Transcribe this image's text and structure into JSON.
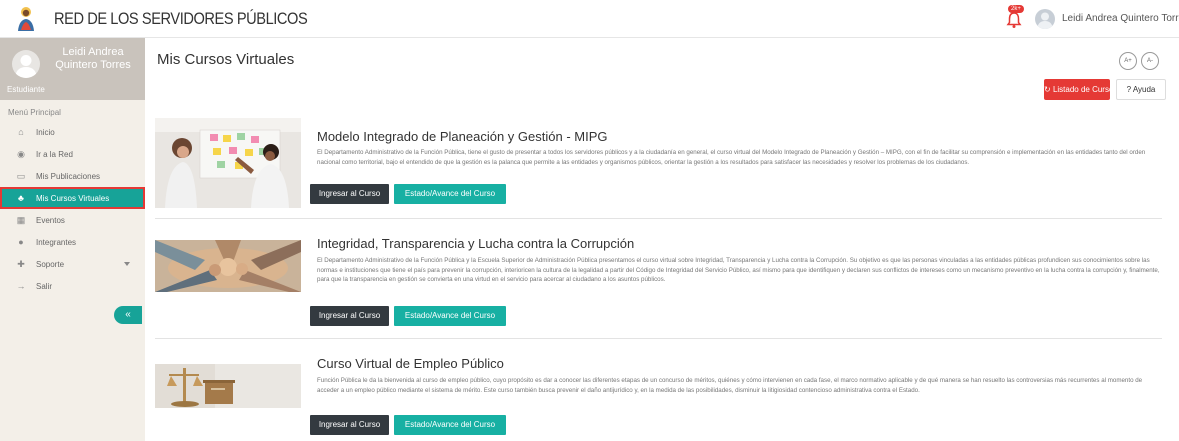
{
  "app": {
    "brand": "RED DE LOS SERVIDORES PÚBLICOS",
    "notification_badge": "2k+",
    "user_name": "Leidi Andrea Quintero Torres"
  },
  "sidebar": {
    "profile_name": "Leidi Andrea Quintero Torres",
    "profile_role": "Estudiante",
    "menu_title": "Menú Principal",
    "items": [
      {
        "label": "Inicio",
        "icon": "home-icon",
        "glyph": "⌂"
      },
      {
        "label": "Ir a la Red",
        "icon": "eye-icon",
        "glyph": "◉"
      },
      {
        "label": "Mis Publicaciones",
        "icon": "document-icon",
        "glyph": "▭"
      },
      {
        "label": "Mis Cursos Virtuales",
        "icon": "courses-icon",
        "glyph": "♣"
      },
      {
        "label": "Eventos",
        "icon": "calendar-icon",
        "glyph": "▦"
      },
      {
        "label": "Integrantes",
        "icon": "user-icon",
        "glyph": "●"
      },
      {
        "label": "Soporte",
        "icon": "support-icon",
        "glyph": "✚"
      },
      {
        "label": "Salir",
        "icon": "logout-icon",
        "glyph": "→"
      }
    ],
    "collapse_glyph": "«"
  },
  "main": {
    "title": "Mis Cursos Virtuales",
    "font_increase": "A+",
    "font_decrease": "A-",
    "listado_label": "Listado de Cursos",
    "ayuda_label": "? Ayuda"
  },
  "courses": [
    {
      "title": "Modelo Integrado de Planeación y Gestión - MIPG",
      "description": "El Departamento Administrativo de la Función Pública, tiene el gusto de presentar a todos los servidores públicos y a la ciudadanía en general, el curso virtual del Modelo Integrado de Planeación y Gestión – MIPG, con el fin de facilitar su comprensión e implementación en las entidades tanto del orden nacional como territorial, bajo el entendido de que la gestión es la palanca que permite a las entidades y organismos públicos, orientar la gestión a los resultados para satisfacer las necesidades y resolver los problemas de los ciudadanos.",
      "enter_label": "Ingresar al Curso",
      "status_label": "Estado/Avance del Curso"
    },
    {
      "title": "Integridad, Transparencia y Lucha contra la Corrupción",
      "description": "El Departamento Administrativo de la Función Pública y la Escuela Superior de Administración Pública presentamos el curso virtual sobre Integridad, Transparencia y Lucha contra la Corrupción. Su objetivo es que las personas vinculadas a las entidades públicas profundicen sus conocimientos sobre las normas e instituciones que tiene el país para prevenir la corrupción, interioricen la cultura de la legalidad a partir del Código de Integridad del Servicio Público, así mismo para que identifiquen y declaren sus conflictos de intereses como un mecanismo preventivo en la lucha contra la corrupción y, finalmente, para que la transparencia en gestión se convierta en una virtud en el servicio para acercar al ciudadano a los asuntos públicos.",
      "enter_label": "Ingresar al Curso",
      "status_label": "Estado/Avance del Curso"
    },
    {
      "title": "Curso Virtual de Empleo Público",
      "description": "Función Pública le da la bienvenida al curso de empleo público, cuyo propósito es dar a conocer las diferentes etapas de un concurso de méritos, quiénes y cómo intervienen en cada fase, el marco normativo aplicable y de qué manera se han resuelto las controversias más recurrentes al momento de acceder a un empleo público mediante el sistema de mérito. Este curso también busca prevenir el daño antijurídico y, en la medida de las posibilidades, disminuir la litigiosidad contencioso administrativa contra el Estado.",
      "enter_label": "Ingresar al Curso",
      "status_label": "Estado/Avance del Curso"
    }
  ],
  "colors": {
    "accent_teal": "#17a398",
    "danger_red": "#e53935",
    "dark_button": "#333a40"
  }
}
